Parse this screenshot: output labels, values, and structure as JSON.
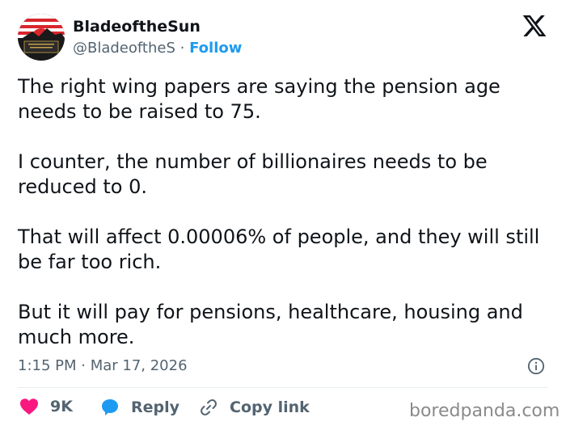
{
  "author": {
    "name": "BladeoftheSun",
    "handle": "@BladeoftheS",
    "separator": "·",
    "follow_label": "Follow"
  },
  "tweet": {
    "paragraphs": [
      "The right wing papers are saying the pension age needs to be raised to 75.",
      "I counter, the number of billionaires needs to be reduced to 0.",
      "That will affect 0.00006% of people, and they will still be far too rich.",
      "But it will pay for pensions, healthcare, housing and much more."
    ],
    "timestamp": "1:15 PM · Mar 17, 2026"
  },
  "actions": {
    "likes": "9K",
    "reply_label": "Reply",
    "copy_label": "Copy link"
  },
  "icons": {
    "platform": "x-logo-icon",
    "info": "info-icon",
    "like": "heart-icon",
    "reply": "speech-bubble-icon",
    "copy": "link-icon"
  },
  "colors": {
    "follow": "#1d9bf0",
    "heart": "#f91880",
    "reply": "#1d9bf0",
    "text": "#0f1419",
    "muted": "#536471"
  },
  "watermark": "boredpanda.com"
}
